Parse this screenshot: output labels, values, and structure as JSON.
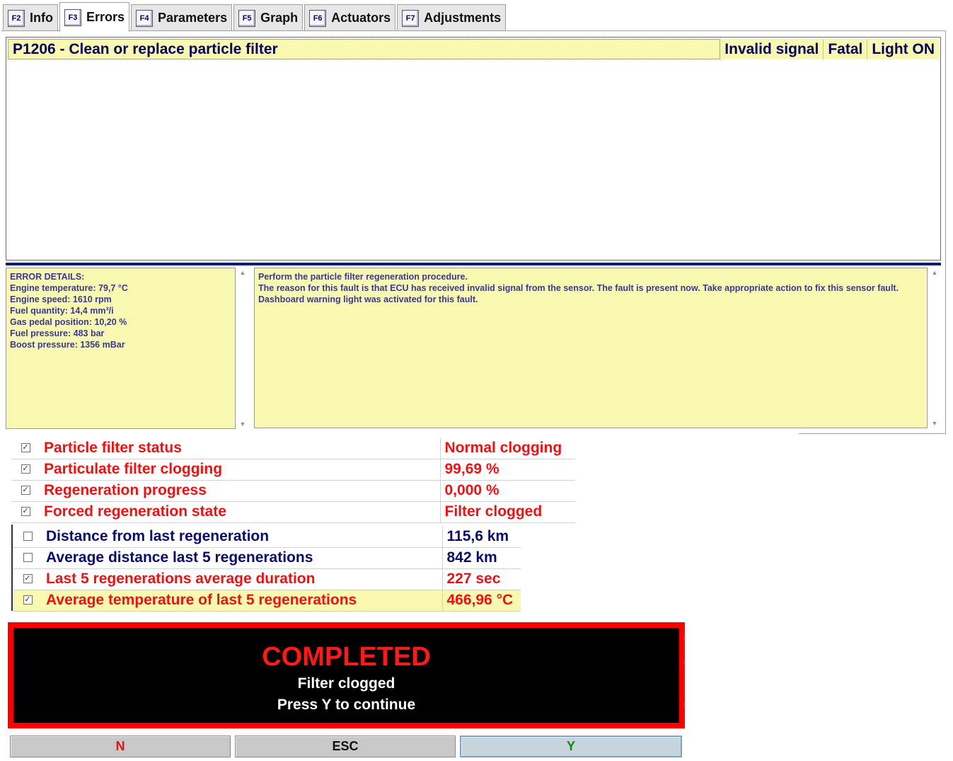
{
  "tabs": [
    {
      "key": "F2",
      "label": "Info"
    },
    {
      "key": "F3",
      "label": "Errors"
    },
    {
      "key": "F4",
      "label": "Parameters"
    },
    {
      "key": "F5",
      "label": "Graph"
    },
    {
      "key": "F6",
      "label": "Actuators"
    },
    {
      "key": "F7",
      "label": "Adjustments"
    }
  ],
  "active_tab": "Errors",
  "errors": [
    {
      "code_desc": "P1206 - Clean or replace particle filter",
      "type": "Invalid signal",
      "severity": "Fatal",
      "light": "Light ON"
    }
  ],
  "error_details": {
    "heading": "ERROR DETAILS:",
    "lines": [
      "Engine temperature: 79,7 °C",
      "Engine speed: 1610 rpm",
      "Fuel quantity: 14,4 mm³/i",
      "Gas pedal position: 10,20 %",
      "Fuel pressure: 483 bar",
      "Boost pressure: 1356 mBar"
    ]
  },
  "error_help": {
    "line1": "Perform the particle filter regeneration procedure.",
    "line2": "The reason for this fault is that ECU has received invalid signal from the sensor. The fault is present now. Take appropriate action to fix this sensor fault. Dashboard warning light was activated for this fault."
  },
  "params_top": [
    {
      "checked": true,
      "name": "Particle filter status",
      "value": "Normal clogging"
    },
    {
      "checked": true,
      "name": "Particulate filter clogging",
      "value": "99,69 %"
    },
    {
      "checked": true,
      "name": "Regeneration progress",
      "value": "0,000 %"
    },
    {
      "checked": true,
      "name": "Forced regeneration state",
      "value": "Filter clogged"
    }
  ],
  "params_bottom": [
    {
      "checked": false,
      "name": "Distance from last regeneration",
      "value": "115,6 km"
    },
    {
      "checked": false,
      "name": "Average distance last 5 regenerations",
      "value": "842 km"
    },
    {
      "checked": true,
      "name": "Last 5 regenerations average duration",
      "value": "227 sec"
    },
    {
      "checked": true,
      "name": "Average temperature of last 5 regenerations",
      "value": "466,96 °C"
    }
  ],
  "completion": {
    "title": "COMPLETED",
    "line1": "Filter clogged",
    "line2": "Press Y to continue"
  },
  "buttons": {
    "n": "N",
    "esc": "ESC",
    "y": "Y"
  },
  "colors": {
    "accent_red": "#ee1111",
    "navy": "#0a0a6e",
    "highlight_yellow": "#f8f8b0",
    "button_green": "#0a8a0a"
  }
}
